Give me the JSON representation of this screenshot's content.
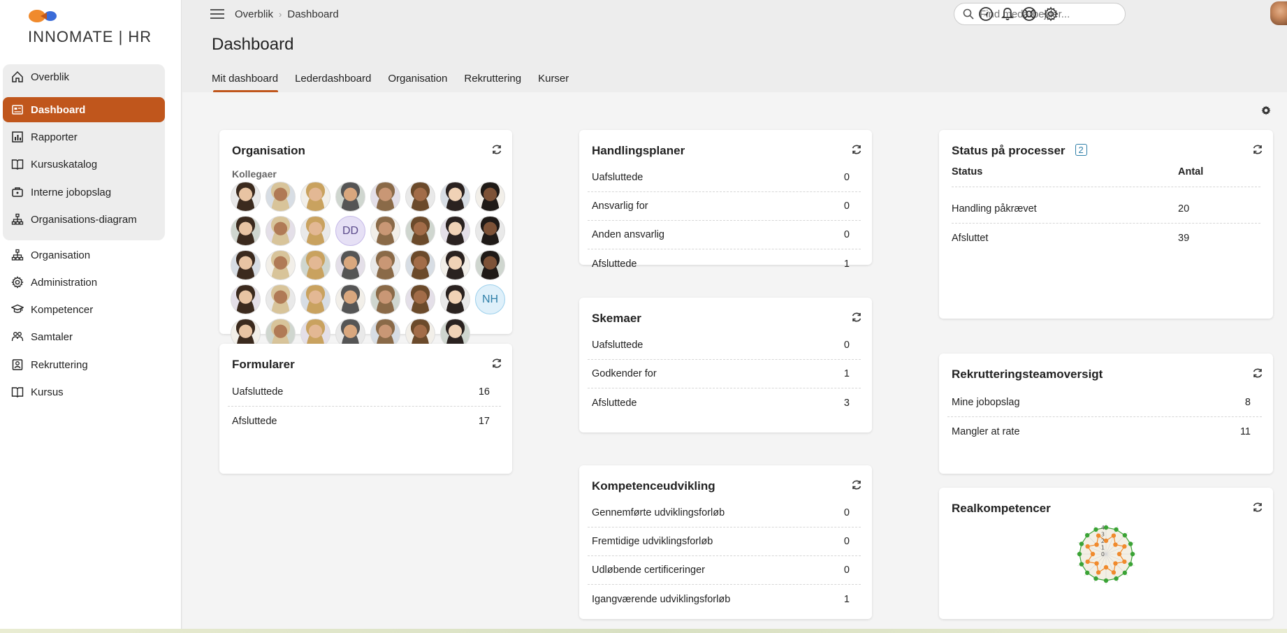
{
  "app": {
    "logo_text": "INNOMATE | HR",
    "accent": "#c0561c"
  },
  "sidebar": {
    "items": [
      {
        "label": "Overblik",
        "icon": "home-icon"
      },
      {
        "label": "Dashboard",
        "icon": "dashboard-icon",
        "active": true
      },
      {
        "label": "Rapporter",
        "icon": "report-icon"
      },
      {
        "label": "Kursuskatalog",
        "icon": "book-icon"
      },
      {
        "label": "Interne jobopslag",
        "icon": "briefcase-icon"
      },
      {
        "label": "Organisations-diagram",
        "icon": "org-chart-icon"
      },
      {
        "label": "Organisation",
        "icon": "org-chart-icon"
      },
      {
        "label": "Administration",
        "icon": "gear-icon"
      },
      {
        "label": "Kompetencer",
        "icon": "graduation-cap-icon"
      },
      {
        "label": "Samtaler",
        "icon": "people-icon"
      },
      {
        "label": "Rekruttering",
        "icon": "badge-icon"
      },
      {
        "label": "Kursus",
        "icon": "book-icon"
      }
    ]
  },
  "header": {
    "breadcrumb": [
      "Overblik",
      "Dashboard"
    ],
    "search_placeholder": "Find medarbejder...",
    "page_title": "Dashboard",
    "tabs": [
      "Mit dashboard",
      "Lederdashboard",
      "Organisation",
      "Rekruttering",
      "Kurser"
    ]
  },
  "cards": {
    "organisation": {
      "title": "Organisation",
      "subtitle": "Kollegaer",
      "avatars": [
        "photo",
        "photo",
        "photo",
        "photo",
        "photo",
        "photo",
        "photo",
        "photo",
        "photo",
        "photo",
        "photo",
        "DD",
        "photo",
        "photo",
        "photo",
        "photo",
        "photo",
        "photo",
        "photo",
        "photo",
        "photo",
        "photo",
        "photo",
        "photo",
        "photo",
        "photo",
        "photo",
        "photo",
        "photo",
        "photo",
        "photo",
        "NH",
        "photo",
        "photo",
        "photo",
        "photo",
        "photo",
        "photo",
        "photo"
      ]
    },
    "formularer": {
      "title": "Formularer",
      "rows": [
        {
          "label": "Uafsluttede",
          "value": "16"
        },
        {
          "label": "Afsluttede",
          "value": "17"
        }
      ]
    },
    "handlingsplaner": {
      "title": "Handlingsplaner",
      "rows": [
        {
          "label": "Uafsluttede",
          "value": "0"
        },
        {
          "label": "Ansvarlig for",
          "value": "0"
        },
        {
          "label": "Anden ansvarlig",
          "value": "0"
        },
        {
          "label": "Afsluttede",
          "value": "1"
        }
      ]
    },
    "skemaer": {
      "title": "Skemaer",
      "rows": [
        {
          "label": "Uafsluttede",
          "value": "0"
        },
        {
          "label": "Godkender for",
          "value": "1"
        },
        {
          "label": "Afsluttede",
          "value": "3"
        }
      ]
    },
    "kompetenceudvikling": {
      "title": "Kompetenceudvikling",
      "rows": [
        {
          "label": "Gennemførte udviklingsforløb",
          "value": "0"
        },
        {
          "label": "Fremtidige udviklingsforløb",
          "value": "0"
        },
        {
          "label": "Udløbende certificeringer",
          "value": "0"
        },
        {
          "label": "Igangværende udviklingsforløb",
          "value": "1"
        }
      ]
    },
    "status": {
      "title": "Status på processer",
      "badge": "2",
      "col_status": "Status",
      "col_antal": "Antal",
      "rows": [
        {
          "label": "Handling påkrævet",
          "value": "20"
        },
        {
          "label": "Afsluttet",
          "value": "39"
        }
      ]
    },
    "rekruttering": {
      "title": "Rekrutteringsteamoversigt",
      "rows": [
        {
          "label": "Mine jobopslag",
          "value": "8"
        },
        {
          "label": "Mangler at rate",
          "value": "11"
        }
      ]
    },
    "realkompetencer": {
      "title": "Realkompetencer",
      "chart_data": {
        "type": "radar",
        "ticks": [
          "4",
          "3",
          "2",
          "1",
          "0"
        ],
        "rmax": 4,
        "series": [
          {
            "color": "#3aa335",
            "values": [
              4,
              4,
              4,
              4,
              4,
              4,
              4,
              4,
              4,
              4,
              4,
              4,
              4,
              4,
              4,
              4
            ]
          },
          {
            "color": "#f08a2c",
            "values": [
              2,
              3,
              2,
              3,
              2,
              3,
              2,
              3,
              2,
              3,
              2,
              3,
              2,
              3,
              2,
              3
            ]
          }
        ]
      }
    }
  }
}
